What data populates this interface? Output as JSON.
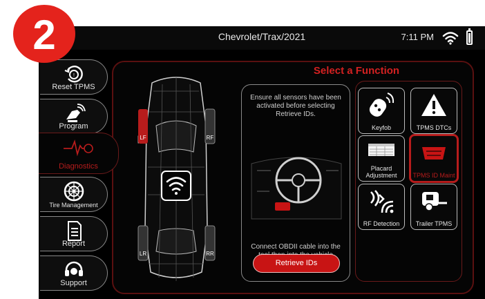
{
  "step_badge": {
    "number": "2",
    "color": "#e4231c"
  },
  "status_bar": {
    "title": "Chevrolet/Trax/2021",
    "time": "7:11 PM",
    "icons": [
      "wifi-icon",
      "battery-icon"
    ],
    "battery_level": 0.85
  },
  "sidebar": {
    "items": [
      {
        "label": "Reset TPMS",
        "icon": "tire-reset-icon",
        "active": false
      },
      {
        "label": "Program",
        "icon": "program-tool-icon",
        "active": false
      },
      {
        "label": "Diagnostics",
        "icon": "heartbeat-icon",
        "active": true
      },
      {
        "label": "Tire Management",
        "icon": "tire-icon",
        "active": false
      },
      {
        "label": "Report",
        "icon": "document-icon",
        "active": false
      },
      {
        "label": "Support",
        "icon": "headset-icon",
        "active": false
      }
    ]
  },
  "main": {
    "title": "Select a Function",
    "car_view": {
      "icon": "wifi-icon",
      "sensor_labels": [
        "LF",
        "RF",
        "LR",
        "RR"
      ],
      "active_sensor": "LF"
    },
    "instructions": {
      "top": "Ensure all sensors have been activated before selecting Retrieve IDs.",
      "bottom": "Connect OBDII cable into the tool then into the vehicle",
      "button": "Retrieve IDs",
      "image": "steering-wheel-obd-icon"
    },
    "functions": [
      {
        "label": "Keyfob",
        "icon": "keyfob-icon",
        "selected": false
      },
      {
        "label": "TPMS DTCs",
        "icon": "warning-icon",
        "selected": false
      },
      {
        "label": "Placard Adjustment",
        "icon": "placard-icon",
        "selected": false
      },
      {
        "label": "TPMS ID Maint",
        "icon": "obd-connector-icon",
        "selected": true
      },
      {
        "label": "RF Detection",
        "icon": "rf-signal-icon",
        "selected": false
      },
      {
        "label": "Trailer TPMS",
        "icon": "trailer-icon",
        "selected": false
      }
    ]
  },
  "colors": {
    "accent": "#c81414",
    "background": "#000000",
    "text": "#e6e6e6"
  }
}
